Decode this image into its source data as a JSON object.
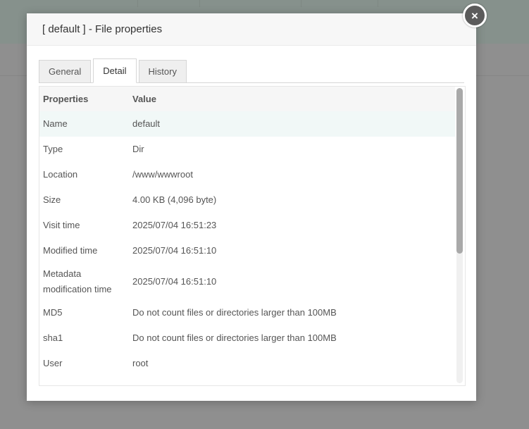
{
  "dialog": {
    "title": "[ default ] - File properties",
    "close_icon": "×"
  },
  "tabs": [
    {
      "label": "General",
      "active": false
    },
    {
      "label": "Detail",
      "active": true
    },
    {
      "label": "History",
      "active": false
    }
  ],
  "table": {
    "headers": {
      "properties": "Properties",
      "value": "Value"
    },
    "rows": [
      {
        "property": "Name",
        "value": "default"
      },
      {
        "property": "Type",
        "value": "Dir"
      },
      {
        "property": "Location",
        "value": "/www/wwwroot"
      },
      {
        "property": "Size",
        "value": "4.00 KB (4,096 byte)"
      },
      {
        "property": "Visit time",
        "value": "2025/07/04 16:51:23"
      },
      {
        "property": "Modified time",
        "value": "2025/07/04 16:51:10"
      },
      {
        "property": "Metadata modification time",
        "value": "2025/07/04 16:51:10"
      },
      {
        "property": "MD5",
        "value": "Do not count files or directories larger than 100MB"
      },
      {
        "property": "sha1",
        "value": "Do not count files or directories larger than 100MB"
      },
      {
        "property": "User",
        "value": "root"
      }
    ]
  },
  "colors": {
    "highlight_row": "#f1f8f7",
    "close_button": "#5b5b5b"
  }
}
